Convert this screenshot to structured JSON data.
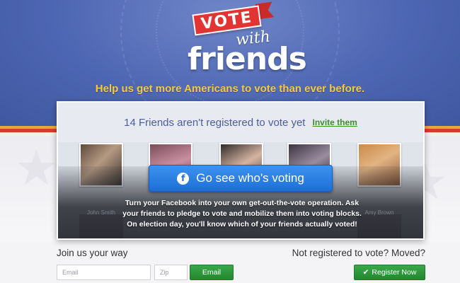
{
  "brand": {
    "vote_word": "VOTE",
    "with_word": "with",
    "friends_word": "friends"
  },
  "tagline": "Help us get more Americans to vote than ever before.",
  "panel": {
    "unregistered_text": "14 Friends aren't registered to vote yet",
    "invite_label": "Invite them",
    "avatar_names": [
      "John Smith",
      "",
      "",
      "",
      "Amy Brown"
    ],
    "cta_label": "Go see who's voting",
    "cta_icon": "facebook-icon",
    "description_lines": [
      "Turn your Facebook into your own get-out-the-vote operation. Ask",
      "your friends to pledge to vote and mobilize them into voting blocks.",
      "On election day, you'll know which of your friends actually voted!"
    ]
  },
  "join": {
    "heading": "Join us your way",
    "email_placeholder": "Email",
    "zip_placeholder": "Zip",
    "email_button": "Email"
  },
  "register": {
    "heading": "Not registered to vote? Moved?",
    "button_label": "Register Now",
    "button_icon": "checkmark-icon"
  },
  "colors": {
    "hero_blue": "#4d66b3",
    "tagline_yellow": "#f3cb3b",
    "logo_red": "#e33434",
    "cta_blue": "#1d6fd6",
    "invite_green": "#3e8e2c",
    "button_green": "#24872f"
  }
}
